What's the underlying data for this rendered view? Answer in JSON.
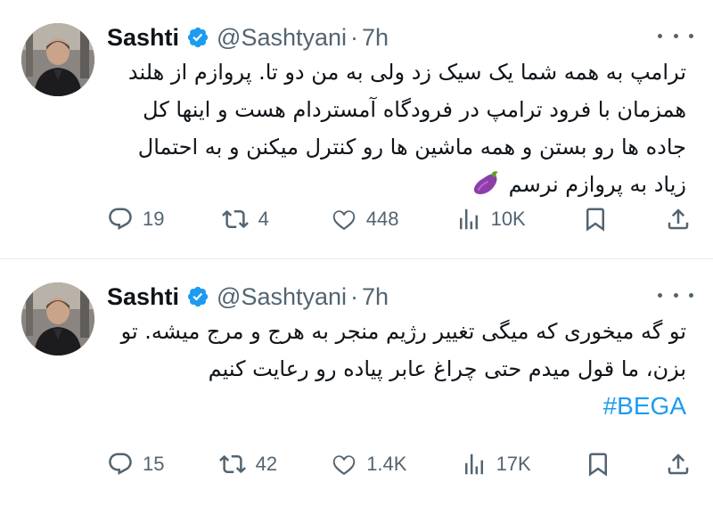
{
  "tweets": [
    {
      "name": "Sashti",
      "handle": "@Sashtyani",
      "separator": "·",
      "time": "7h",
      "text": "ترامپ به همه شما یک سیک زد ولی به من دو تا. پروازم از هلند همزمان با فرود ترامپ در فرودگاه آمستردام هست و اینها کل جاده ها رو بستن و همه ماشین ها رو کنترل میکنن و به احتمال زیاد به پروازم نرسم",
      "emoji": "eggplant-emoji",
      "hashtag": "",
      "replies": "19",
      "reposts": "4",
      "likes": "448",
      "views": "10K"
    },
    {
      "name": "Sashti",
      "handle": "@Sashtyani",
      "separator": "·",
      "time": "7h",
      "text": "تو گه میخوری که میگی تغییر رژیم منجر به هرج و مرج میشه. تو بزن، ما قول میدم حتی چراغ عابر پیاده رو رعایت کنیم",
      "emoji": "",
      "hashtag": "#BEGA",
      "replies": "15",
      "reposts": "42",
      "likes": "1.4K",
      "views": "17K"
    }
  ],
  "colors": {
    "text": "#0f1419",
    "secondary": "#536471",
    "verified": "#1d9bf0",
    "hashtag": "#1d9bf0",
    "divider": "#e6e9eb"
  },
  "icons": [
    "verified-badge-icon",
    "more-icon",
    "reply-icon",
    "repost-icon",
    "like-icon",
    "views-icon",
    "bookmark-icon",
    "share-icon",
    "eggplant-emoji"
  ]
}
